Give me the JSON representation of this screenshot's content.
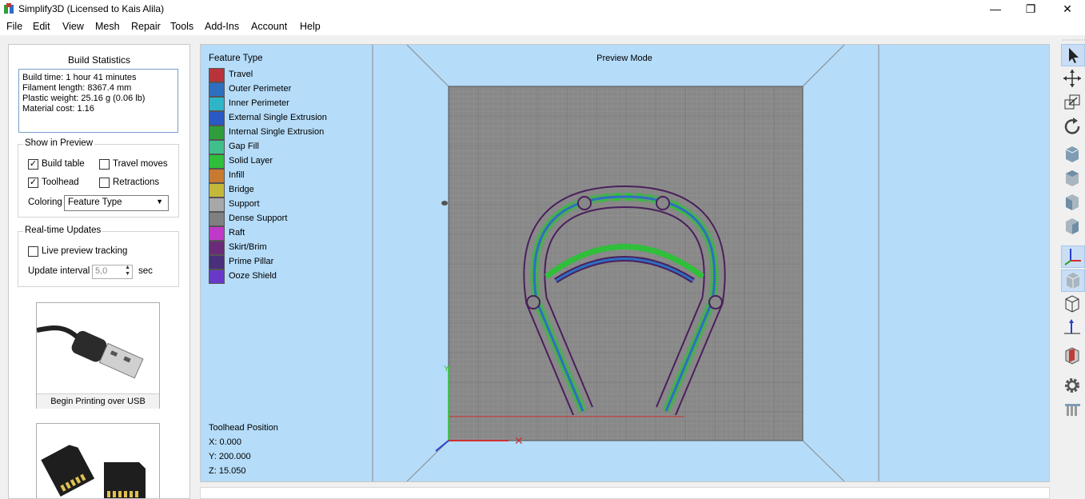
{
  "window": {
    "title": "Simplify3D (Licensed to Kais Alila)"
  },
  "menu": [
    "File",
    "Edit",
    "View",
    "Mesh",
    "Repair",
    "Tools",
    "Add-Ins",
    "Account",
    "Help"
  ],
  "build_statistics": {
    "title": "Build Statistics",
    "lines": [
      "Build time: 1 hour 41 minutes",
      "Filament length: 8367.4 mm",
      "Plastic weight: 25.16 g (0.06 lb)",
      "Material cost: 1.16"
    ]
  },
  "show_in_preview": {
    "title": "Show in Preview",
    "build_table": {
      "label": "Build table",
      "checked": true
    },
    "travel_moves": {
      "label": "Travel moves",
      "checked": false
    },
    "toolhead": {
      "label": "Toolhead",
      "checked": true
    },
    "retractions": {
      "label": "Retractions",
      "checked": false
    },
    "coloring_label": "Coloring",
    "coloring_value": "Feature Type"
  },
  "realtime": {
    "title": "Real-time Updates",
    "live_tracking": {
      "label": "Live preview tracking",
      "checked": false
    },
    "interval_label": "Update interval",
    "interval_value": "5,0",
    "interval_unit": "sec"
  },
  "print_buttons": {
    "usb_label": "Begin Printing over USB"
  },
  "legend": {
    "title": "Feature Type",
    "items": [
      {
        "label": "Travel",
        "color": "#b8343a"
      },
      {
        "label": "Outer Perimeter",
        "color": "#2e6fc0"
      },
      {
        "label": "Inner Perimeter",
        "color": "#2fb5c8"
      },
      {
        "label": "External Single Extrusion",
        "color": "#2a58c4"
      },
      {
        "label": "Internal Single Extrusion",
        "color": "#2f9e3a"
      },
      {
        "label": "Gap Fill",
        "color": "#3fbf8a"
      },
      {
        "label": "Solid Layer",
        "color": "#2fbf3a"
      },
      {
        "label": "Infill",
        "color": "#c87a30"
      },
      {
        "label": "Bridge",
        "color": "#c4b83a"
      },
      {
        "label": "Support",
        "color": "#a8a8a8"
      },
      {
        "label": "Dense Support",
        "color": "#808080"
      },
      {
        "label": "Raft",
        "color": "#c03ac8"
      },
      {
        "label": "Skirt/Brim",
        "color": "#6a2c78"
      },
      {
        "label": "Prime Pillar",
        "color": "#4a2f7a"
      },
      {
        "label": "Ooze Shield",
        "color": "#6a38c8"
      }
    ]
  },
  "viewport": {
    "mode": "Preview Mode",
    "background": "#b5dcf9"
  },
  "toolhead_position": {
    "title": "Toolhead Position",
    "x": "X: 0.000",
    "y": "Y: 200.000",
    "z": "Z: 15.050"
  },
  "right_toolbar": [
    "select-tool-icon",
    "move-tool-icon",
    "scale-tool-icon",
    "rotate-tool-icon",
    "view-front-icon",
    "view-top-icon",
    "view-side-icon",
    "view-iso-icon",
    "axes-icon",
    "solid-view-icon",
    "wireframe-view-icon",
    "normals-icon",
    "cross-section-icon",
    "settings-icon",
    "supports-icon"
  ]
}
